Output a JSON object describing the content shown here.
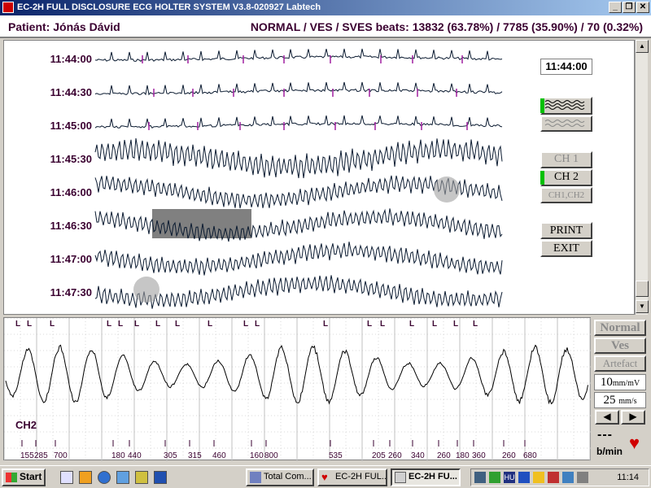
{
  "window": {
    "title": "EC-2H FULL DISCLOSURE ECG HOLTER SYSTEM   V3.8-020927   Labtech",
    "buttons": {
      "minimize": "_",
      "restore": "❐",
      "close": "✕"
    }
  },
  "header": {
    "patient": "Patient: Jónás Dávid",
    "beats": "NORMAL / VES / SVES beats: 13832 (63.78%) / 7785 (35.90%) / 70 (0.32%)"
  },
  "overview": {
    "times": [
      "11:44:00",
      "11:44:30",
      "11:45:00",
      "11:45:30",
      "11:46:00",
      "11:46:30",
      "11:47:00",
      "11:47:30"
    ],
    "current_time": "11:44:00",
    "scroll": {
      "up": "▲",
      "down": "▼"
    }
  },
  "controls": {
    "ch1": "CH 1",
    "ch2": "CH 2",
    "ch12": "CH1,CH2",
    "print": "PRINT",
    "exit": "EXIT"
  },
  "detail": {
    "channel": "CH2",
    "rr_values": [
      "155",
      "285",
      "700",
      "180",
      "440",
      "305",
      "315",
      "460",
      "160",
      "800",
      "535",
      "205",
      "260",
      "340",
      "260",
      "180",
      "360",
      "260",
      "680"
    ],
    "beat_marks": [
      "L",
      "L",
      "L",
      "L",
      "L",
      "L",
      "L",
      "L",
      "L",
      "L",
      "L",
      "L",
      "L",
      "L",
      "L",
      "L",
      "L",
      "L"
    ]
  },
  "right_panel": {
    "normal": "Normal",
    "ves": "Ves",
    "artefact": "Artefact",
    "gain_value": "10",
    "gain_unit": "mm/mV",
    "speed_value": "25",
    "speed_unit": "mm/s",
    "prev": "◀",
    "next": "▶",
    "bpm_value": "---",
    "bpm_unit": "b/min"
  },
  "taskbar": {
    "start": "Start",
    "tasks": [
      "Total Com...",
      "EC-2H FUL...",
      "EC-2H FU..."
    ],
    "clock": "11:14"
  },
  "colors": {
    "trace": "#0a1a30",
    "annotation": "#3a0030",
    "highlight": "#808080",
    "ves_marker": "#a020a0"
  }
}
